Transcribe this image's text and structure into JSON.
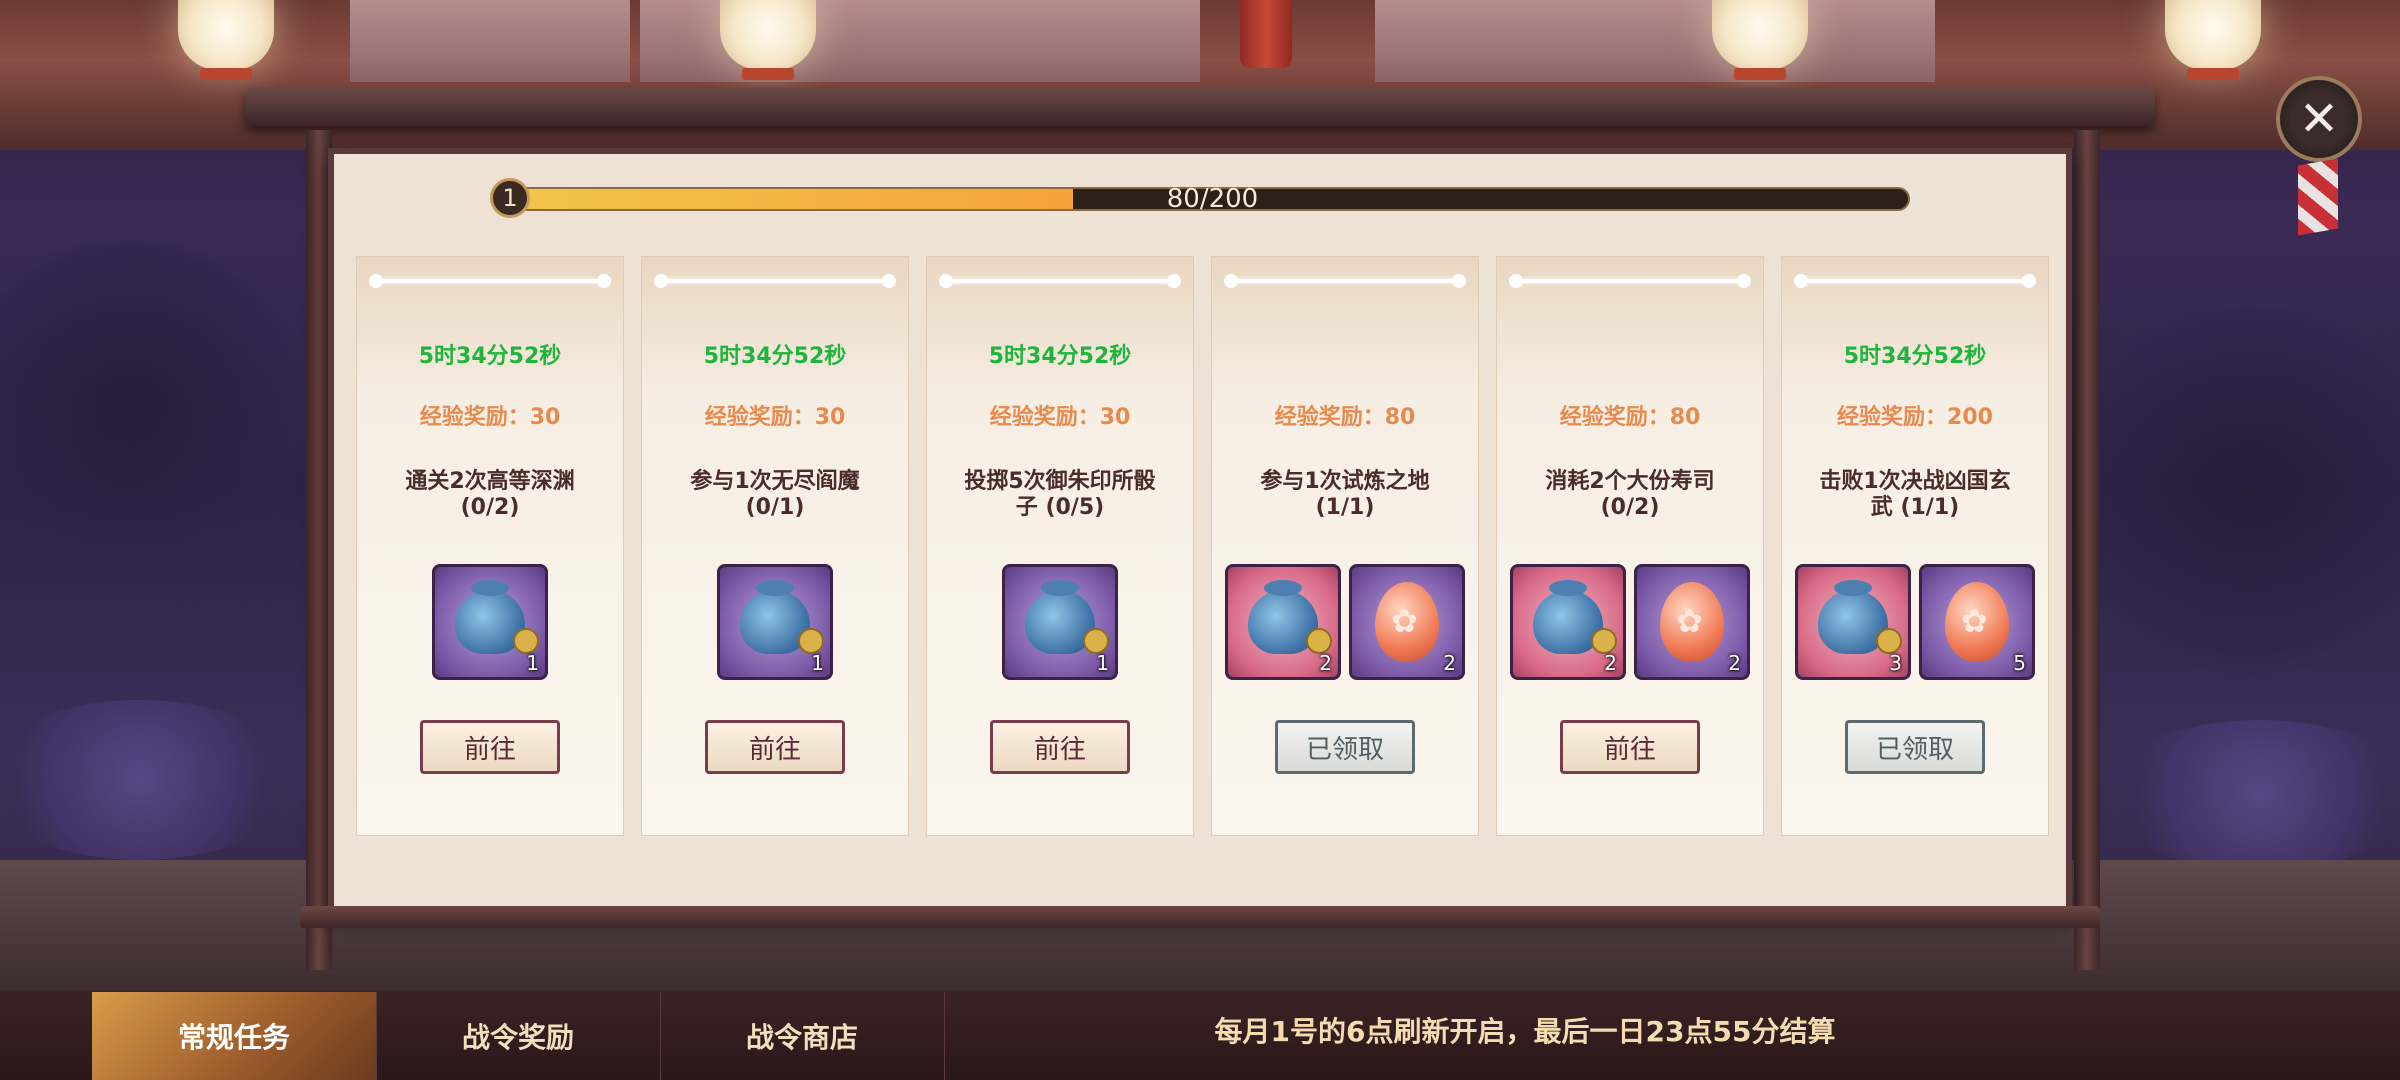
{
  "progress": {
    "level": "1",
    "text": "80/200",
    "fraction": 0.4
  },
  "tasks": [
    {
      "timer": "5时34分52秒",
      "exp": "经验奖励：30",
      "line1": "通关2次高等深渊",
      "line2": "(0/2)",
      "rewards": [
        {
          "icon": "blue-pouch-icon",
          "bg": "purple",
          "count": "1"
        }
      ],
      "button": "前往",
      "button_state": "go"
    },
    {
      "timer": "5时34分52秒",
      "exp": "经验奖励：30",
      "line1": "参与1次无尽阎魔",
      "line2": "(0/1)",
      "rewards": [
        {
          "icon": "blue-pouch-icon",
          "bg": "purple",
          "count": "1"
        }
      ],
      "button": "前往",
      "button_state": "go"
    },
    {
      "timer": "5时34分52秒",
      "exp": "经验奖励：30",
      "line1": "投掷5次御朱印所骰",
      "line2": "子 (0/5)",
      "rewards": [
        {
          "icon": "blue-pouch-icon",
          "bg": "purple",
          "count": "1"
        }
      ],
      "button": "前往",
      "button_state": "go"
    },
    {
      "timer": "",
      "exp": "经验奖励：80",
      "line1": "参与1次试炼之地",
      "line2": "(1/1)",
      "rewards": [
        {
          "icon": "blue-pouch-icon",
          "bg": "red",
          "count": "2"
        },
        {
          "icon": "orange-egg-icon",
          "bg": "purple",
          "count": "2"
        }
      ],
      "button": "已领取",
      "button_state": "done"
    },
    {
      "timer": "",
      "exp": "经验奖励：80",
      "line1": "消耗2个大份寿司",
      "line2": "(0/2)",
      "rewards": [
        {
          "icon": "blue-pouch-icon",
          "bg": "red",
          "count": "2"
        },
        {
          "icon": "orange-egg-icon",
          "bg": "purple",
          "count": "2"
        }
      ],
      "button": "前往",
      "button_state": "go"
    },
    {
      "timer": "5时34分52秒",
      "exp": "经验奖励：200",
      "line1": "击败1次决战凶国玄",
      "line2": "武 (1/1)",
      "rewards": [
        {
          "icon": "blue-pouch-icon",
          "bg": "red",
          "count": "3"
        },
        {
          "icon": "orange-egg-icon",
          "bg": "purple",
          "count": "5"
        }
      ],
      "button": "已领取",
      "button_state": "done"
    }
  ],
  "tabs": [
    {
      "label": "常规任务",
      "active": true
    },
    {
      "label": "战令奖励",
      "active": false
    },
    {
      "label": "战令商店",
      "active": false
    }
  ],
  "notice": "每月1号的6点刷新开启，最后一日23点55分结算",
  "close_icon": "close-icon"
}
